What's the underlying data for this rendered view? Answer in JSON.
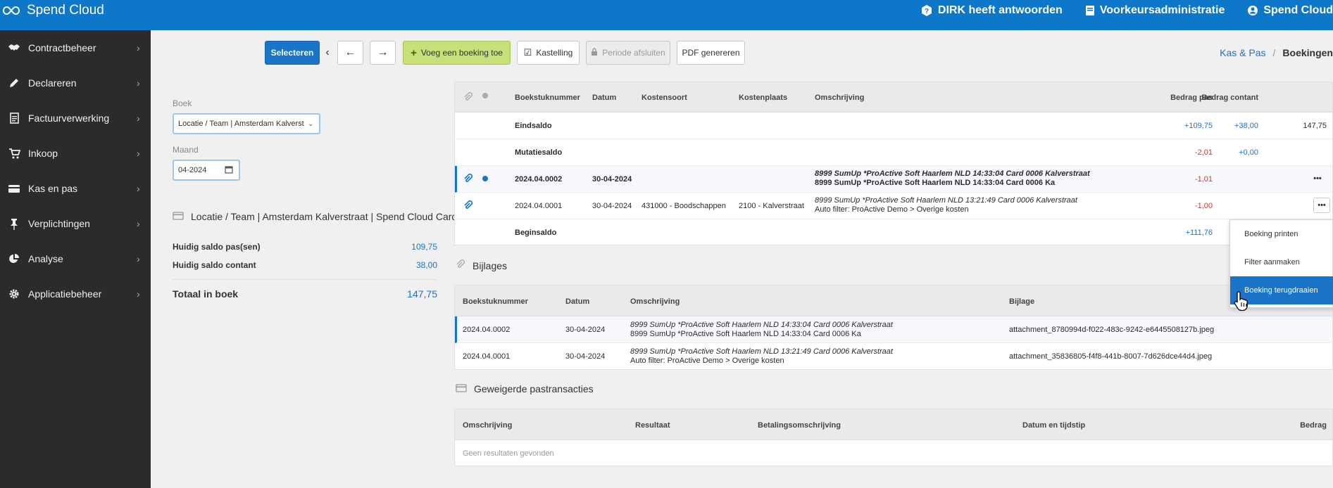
{
  "app": {
    "title": "Spend Cloud"
  },
  "topnav": [
    {
      "label": "DIRK heeft antwoorden",
      "icon": "help-question-icon"
    },
    {
      "label": "Voorkeursadministratie",
      "icon": "book-icon"
    },
    {
      "label": "Spend Cloud",
      "icon": "user-icon"
    }
  ],
  "sidebar": {
    "items": [
      {
        "label": "Contractbeheer",
        "icon": "handshake-icon"
      },
      {
        "label": "Declareren",
        "icon": "pencil-icon"
      },
      {
        "label": "Factuurverwerking",
        "icon": "invoice-icon"
      },
      {
        "label": "Inkoop",
        "icon": "cart-icon"
      },
      {
        "label": "Kas en pas",
        "icon": "credit-card-icon"
      },
      {
        "label": "Verplichtingen",
        "icon": "pin-icon"
      },
      {
        "label": "Analyse",
        "icon": "pie-chart-icon"
      },
      {
        "label": "Applicatiebeheer",
        "icon": "gear-icon"
      }
    ]
  },
  "toolbar": {
    "select": "Selecteren",
    "add": "Voeg een boeking toe",
    "kastelling": "Kastelling",
    "periode": "Periode afsluiten",
    "pdf": "PDF genereren"
  },
  "breadcrumb": {
    "parent": "Kas & Pas",
    "current": "Boekingen"
  },
  "filters": {
    "boek_label": "Boek",
    "boek_value": "Locatie / Team | Amsterdam Kalverst",
    "maand_label": "Maand",
    "maand_value": "04-2024"
  },
  "summary": {
    "title": "Locatie / Team | Amsterdam Kalverstraat | Spend Cloud Card",
    "pas_label": "Huidig saldo pas(sen)",
    "pas_value": "109,75",
    "contant_label": "Huidig saldo contant",
    "contant_value": "38,00",
    "total_label": "Totaal in boek",
    "total_value": "147,75"
  },
  "bookings": {
    "headers": {
      "nummer": "Boekstuknummer",
      "datum": "Datum",
      "kostensoort": "Kostensoort",
      "kostenplaats": "Kostenplaats",
      "omschrijving": "Omschrijving",
      "pas": "Bedrag pas",
      "contant": "Bedrag contant"
    },
    "eindsaldo": {
      "label": "Eindsaldo",
      "pas": "+109,75",
      "contant": "+38,00",
      "total": "147,75"
    },
    "mutatiesaldo": {
      "label": "Mutatiesaldo",
      "pas": "-2,01",
      "contant": "+0,00"
    },
    "rows": [
      {
        "nummer": "2024.04.0002",
        "datum": "30-04-2024",
        "kostensoort": "",
        "kostenplaats": "",
        "omschrijving1": "8999 SumUp *ProActive Soft Haarlem NLD 14:33:04 Card 0006 Kalverstraat",
        "omschrijving2": "8999 SumUp *ProActive Soft Haarlem NLD 14:33:04 Card 0006 Ka",
        "pas": "-1,01"
      },
      {
        "nummer": "2024.04.0001",
        "datum": "30-04-2024",
        "kostensoort": "431000 - Boodschappen",
        "kostenplaats": "2100 - Kalverstraat",
        "omschrijving1": "8999 SumUp *ProActive Soft Haarlem NLD 13:21:49 Card 0006 Kalverstraat",
        "omschrijving2": "Auto filter: ProActive Demo > Overige kosten",
        "pas": "-1,00"
      }
    ],
    "beginsaldo": {
      "label": "Beginsaldo",
      "pas": "+111,76",
      "contant": "+38,00"
    },
    "more": "•••"
  },
  "dropdown": {
    "items": [
      "Boeking printen",
      "Filter aanmaken",
      "Boeking terugdraaien"
    ]
  },
  "bijlages": {
    "title": "Bijlages",
    "headers": {
      "nummer": "Boekstuknummer",
      "datum": "Datum",
      "omschrijving": "Omschrijving",
      "bijlage": "Bijlage"
    },
    "rows": [
      {
        "nummer": "2024.04.0002",
        "datum": "30-04-2024",
        "omschrijving1": "8999 SumUp *ProActive Soft Haarlem NLD 14:33:04 Card 0006 Kalverstraat",
        "omschrijving2": "8999 SumUp *ProActive Soft Haarlem NLD 14:33:04 Card 0006 Ka",
        "bijlage": "attachment_8780994d-f022-483c-9242-e6445508127b.jpeg"
      },
      {
        "nummer": "2024.04.0001",
        "datum": "30-04-2024",
        "omschrijving1": "8999 SumUp *ProActive Soft Haarlem NLD 13:21:49 Card 0006 Kalverstraat",
        "omschrijving2": "Auto filter: ProActive Demo > Overige kosten",
        "bijlage": "attachment_35836805-f4f8-441b-8007-7d626dce44d4.jpeg"
      }
    ]
  },
  "geweigerde": {
    "title": "Geweigerde pastransacties",
    "headers": {
      "omschrijving": "Omschrijving",
      "resultaat": "Resultaat",
      "betaling": "Betalingsomschrijving",
      "datum": "Datum en tijdstip",
      "bedrag": "Bedrag"
    },
    "empty": "Geen resultaten gevonden"
  }
}
